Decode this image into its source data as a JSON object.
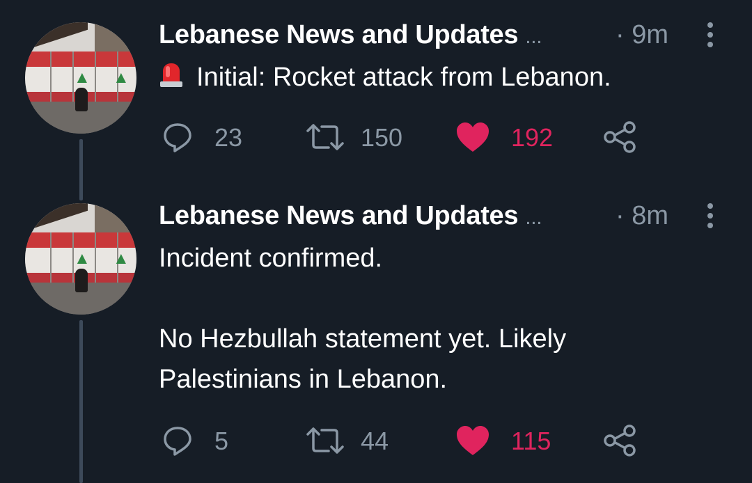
{
  "tweets": [
    {
      "author": "Lebanese News and Updates",
      "ellipsis": "...",
      "time": "· 9m",
      "text_emoji": "rotating-light-siren",
      "text": [
        "Initial:  Rocket attack from Lebanon."
      ],
      "replies": "23",
      "retweets": "150",
      "likes": "192"
    },
    {
      "author": "Lebanese News and Updates",
      "ellipsis": "...",
      "time": "· 8m",
      "text": [
        "Incident confirmed.",
        "No Hezbullah statement yet. Likely",
        "Palestinians in Lebanon."
      ],
      "replies": "5",
      "retweets": "44",
      "likes": "115"
    }
  ],
  "icons": {
    "reply": "reply-icon",
    "retweet": "retweet-icon",
    "like": "heart-icon",
    "share": "share-icon",
    "more": "more-icon"
  },
  "colors": {
    "background": "#161d26",
    "text": "#ffffff",
    "muted": "#8b98a5",
    "like": "#e0245e",
    "thread_line": "#3d4a5a"
  }
}
